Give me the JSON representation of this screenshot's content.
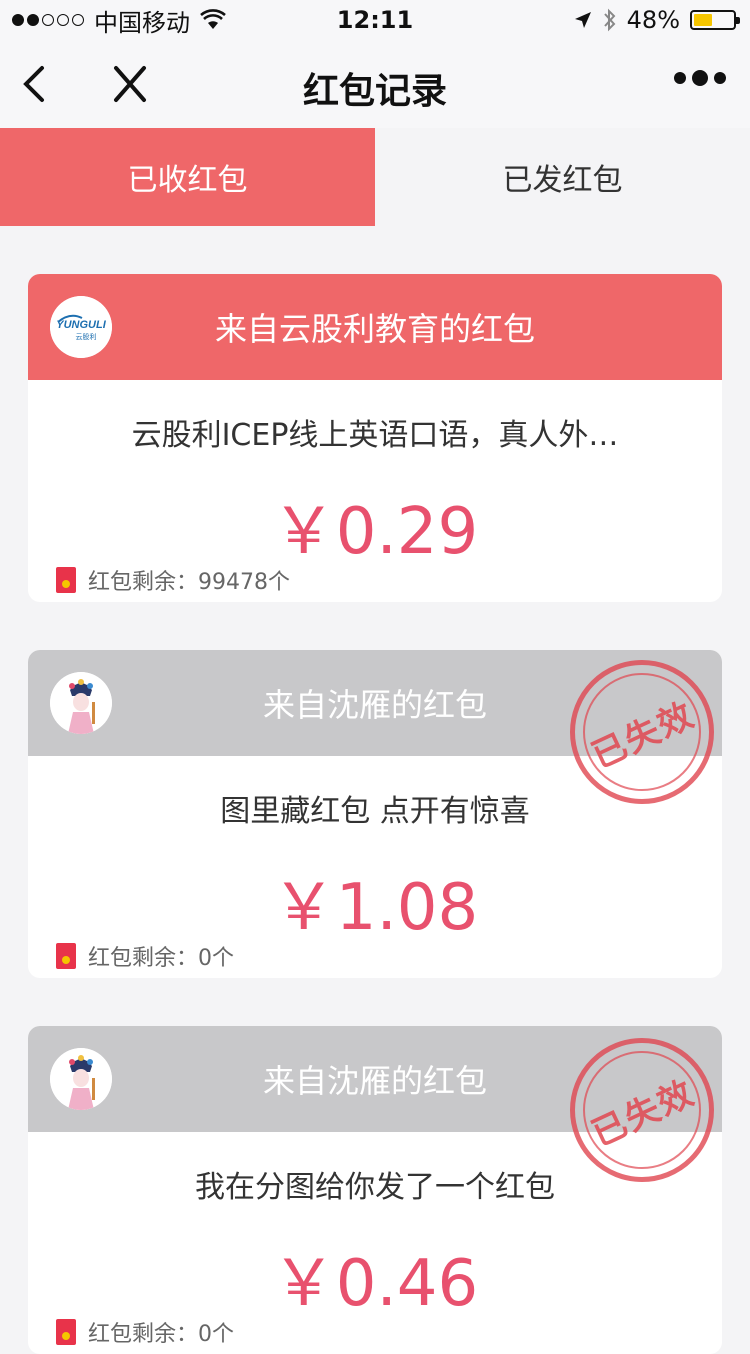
{
  "status_bar": {
    "carrier": "中国移动",
    "time": "12:11",
    "battery": "48%",
    "battery_level": 0.48,
    "signal_bars_filled": 2,
    "signal_bars_total": 5
  },
  "nav": {
    "title": "红包记录",
    "back_icon": "chevron-left-icon",
    "close_icon": "close-icon",
    "more_icon": "more-dots-icon"
  },
  "tabs": [
    {
      "label": "已收红包",
      "active": true
    },
    {
      "label": "已发红包",
      "active": false
    }
  ],
  "cards": [
    {
      "from": "来自云股利教育的红包",
      "avatar_text": "YUNGULI",
      "avatar_subtext": "云股利",
      "description": "云股利ICEP线上英语口语，真人外…",
      "amount": "￥0.29",
      "remain": "红包剩余：99478个",
      "expired": false,
      "header_color": "#ef6769"
    },
    {
      "from": "来自沈雁的红包",
      "description": "图里藏红包 点开有惊喜",
      "amount": "￥1.08",
      "remain": "红包剩余：0个",
      "expired": true,
      "stamp": "已失效",
      "header_color": "#c8c8ca"
    },
    {
      "from": "来自沈雁的红包",
      "description": "我在分图给你发了一个红包",
      "amount": "￥0.46",
      "remain": "红包剩余：0个",
      "expired": true,
      "stamp": "已失效",
      "header_color": "#c8c8ca"
    }
  ],
  "colors": {
    "accent_red": "#ef6769",
    "amount_pink": "#e8516e",
    "expired_gray": "#c8c8ca"
  }
}
